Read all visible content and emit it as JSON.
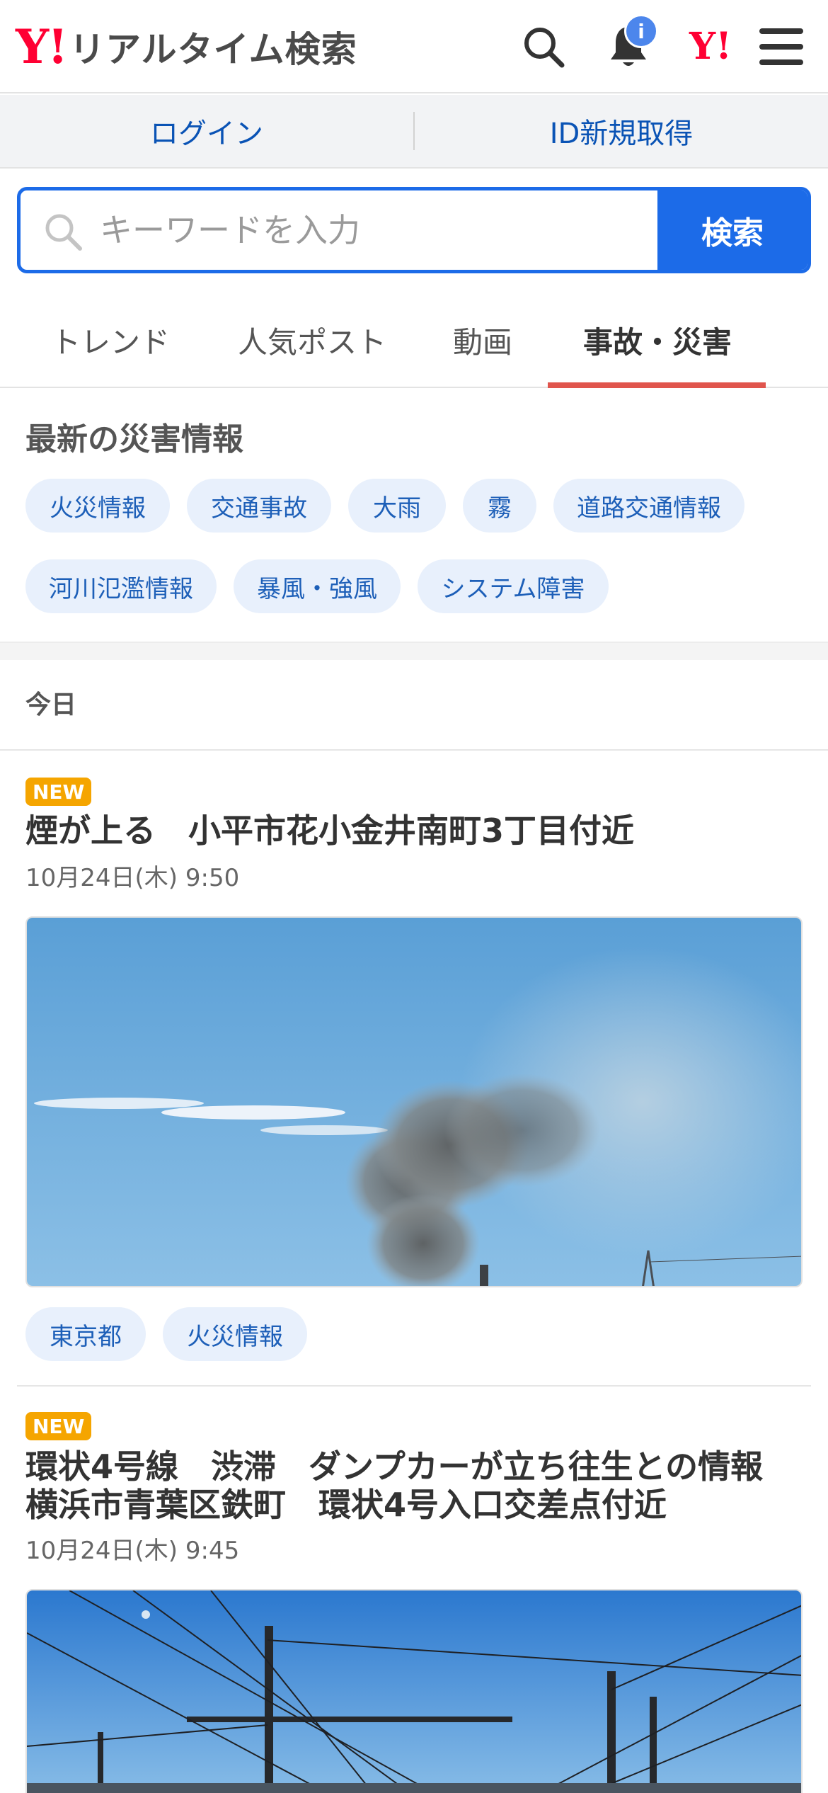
{
  "header": {
    "logo_mark": "Y!",
    "title": "リアルタイム検索",
    "notification_badge": "i",
    "yj_mark": "Y!"
  },
  "loginbar": {
    "login_label": "ログイン",
    "register_label": "ID新規取得"
  },
  "search": {
    "placeholder": "キーワードを入力",
    "button_label": "検索"
  },
  "tabs": [
    {
      "label": "トレンド",
      "active": false
    },
    {
      "label": "人気ポスト",
      "active": false
    },
    {
      "label": "動画",
      "active": false
    },
    {
      "label": "事故・災害",
      "active": true
    }
  ],
  "disaster": {
    "title": "最新の災害情報",
    "chips": [
      "火災情報",
      "交通事故",
      "大雨",
      "霧",
      "道路交通情報",
      "河川氾濫情報",
      "暴風・強風",
      "システム障害"
    ]
  },
  "day_label": "今日",
  "articles": [
    {
      "badge": "NEW",
      "title": "煙が上る　小平市花小金井南町3丁目付近",
      "date": "10月24日(木) 9:50",
      "tags": [
        "東京都",
        "火災情報"
      ]
    },
    {
      "badge": "NEW",
      "title_line1": "環状4号線　渋滞　ダンプカーが立ち往生との情報",
      "title_line2": "横浜市青葉区鉄町　環状4号入口交差点付近",
      "date": "10月24日(木) 9:45"
    }
  ],
  "colors": {
    "brand_red": "#ff0033",
    "accent_blue": "#1c6be8",
    "link_blue": "#0a53b5",
    "chip_bg": "#e8f0fc",
    "tab_underline": "#e0554d",
    "new_badge": "#f5a500"
  },
  "icons": [
    "search-icon",
    "bell-icon",
    "yahoo-japan-icon",
    "hamburger-menu-icon"
  ]
}
